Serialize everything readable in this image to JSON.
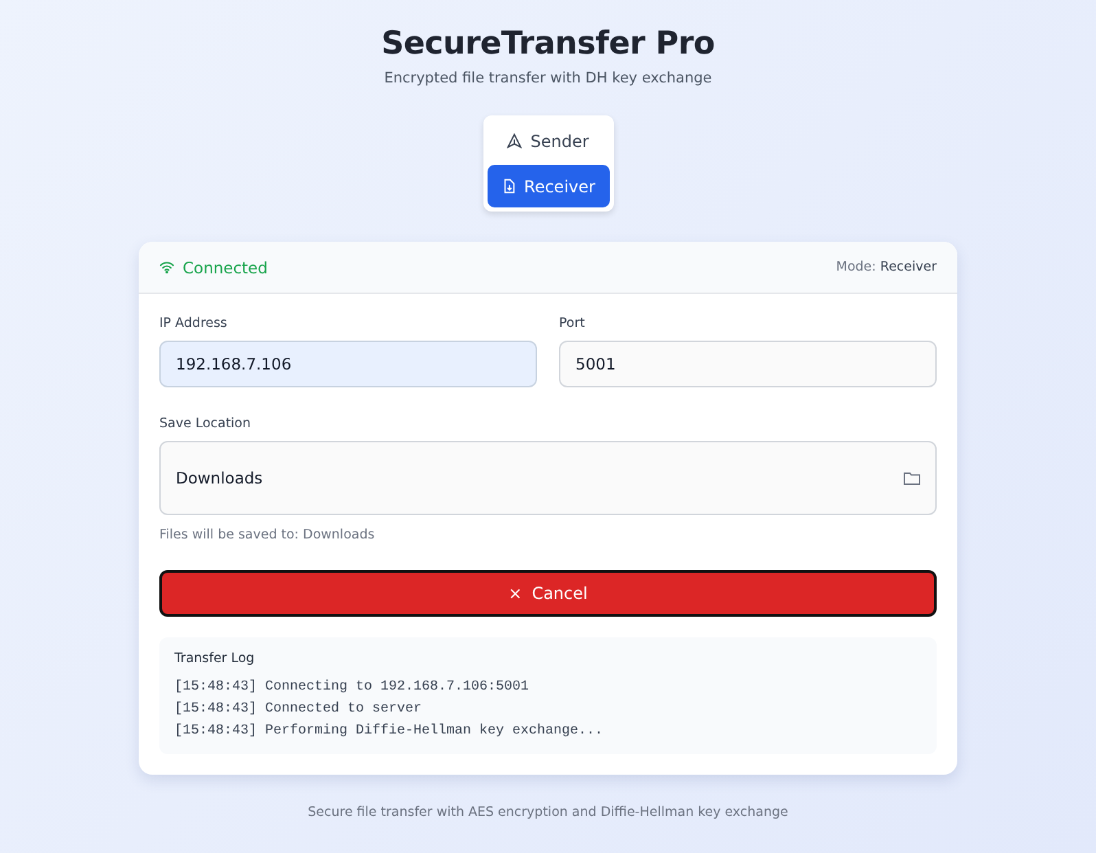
{
  "header": {
    "title": "SecureTransfer Pro",
    "subtitle": "Encrypted file transfer with DH key exchange"
  },
  "modes": [
    {
      "label": "Sender",
      "kind": "send",
      "selected": false
    },
    {
      "label": "Receiver",
      "kind": "receive",
      "selected": true
    }
  ],
  "status": {
    "text": "Connected",
    "connected": true,
    "mode_label": "Mode:",
    "mode_value": "Receiver"
  },
  "fields": [
    {
      "label": "IP Address",
      "value": "192.168.7.106",
      "focused": true
    },
    {
      "label": "Port",
      "value": "5001",
      "focused": false
    }
  ],
  "save_location": {
    "label": "Save Location",
    "value": "Downloads",
    "hint": "Files will be saved to: Downloads"
  },
  "cancel_button": {
    "label": "Cancel",
    "glyph": "×"
  },
  "log": {
    "title": "Transfer Log",
    "lines": [
      "[15:48:43] Connecting to 192.168.7.106:5001",
      "[15:48:43] Connected to server",
      "[15:48:43] Performing Diffie-Hellman key exchange..."
    ]
  },
  "footer": "Secure file transfer with AES encryption and Diffie-Hellman key exchange"
}
